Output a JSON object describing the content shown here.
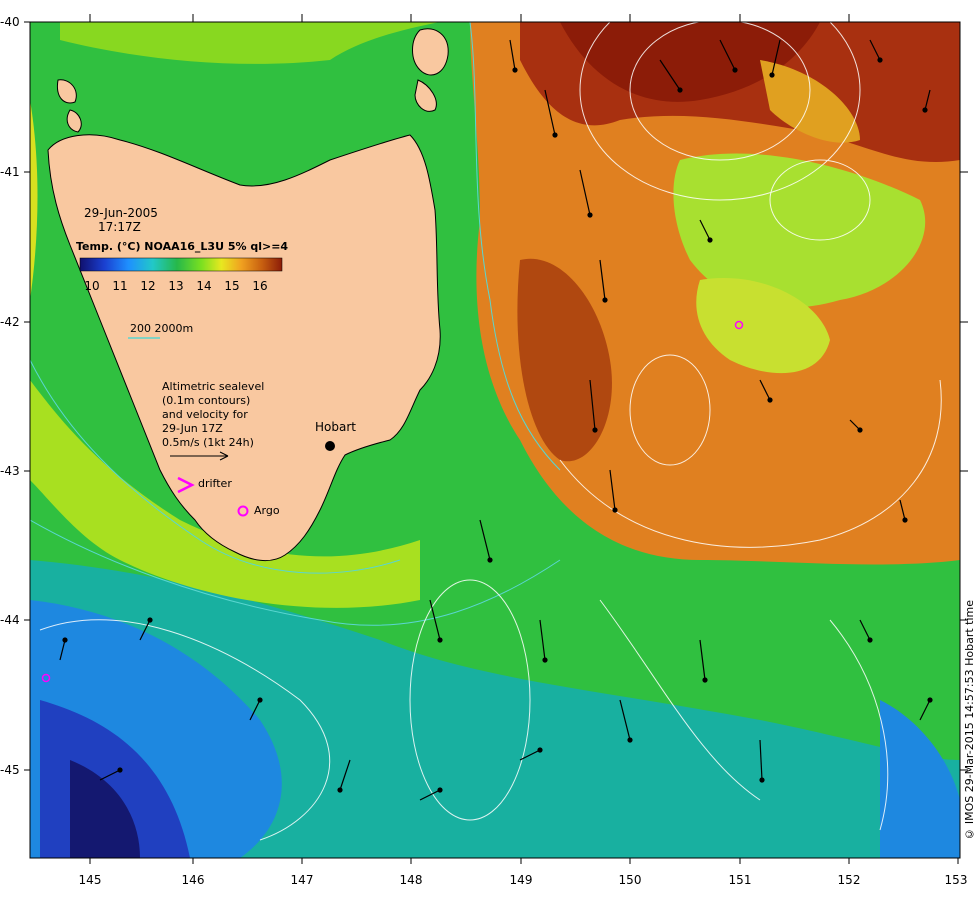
{
  "map": {
    "date_line": "29-Jun-2005",
    "time_line": "17:17Z",
    "product_title": "Temp. (°C) NOAA16_L3U 5% ql>=4",
    "colorbar_ticks": [
      "10",
      "11",
      "12",
      "13",
      "14",
      "15",
      "16"
    ],
    "colorbar_colors": [
      "#10106e",
      "#1a3fd0",
      "#1e90ff",
      "#22c8c8",
      "#26b84a",
      "#7ae020",
      "#e8e820",
      "#f0a020",
      "#c86010",
      "#8c1c08"
    ],
    "isobath_label": "200  2000m",
    "isobath_color": "#5ad6d0",
    "altimetry_lines": [
      "Altimetric sealevel",
      "(0.1m contours)",
      "and velocity for",
      "29-Jun 17Z",
      "0.5m/s (1kt 24h)"
    ],
    "drifter_label": "drifter",
    "argo_label": "Argo",
    "marker_color": "#ff00ff",
    "land_color": "#f9c8a0",
    "city_label": "Hobart",
    "credit": "© IMOS 29-Mar-2015 14:57:53 Hobart time",
    "lat_labels": [
      "-40",
      "-41",
      "-42",
      "-43",
      "-44",
      "-45"
    ],
    "lon_labels": [
      "145",
      "146",
      "147",
      "148",
      "149",
      "150",
      "151",
      "152",
      "153"
    ]
  }
}
